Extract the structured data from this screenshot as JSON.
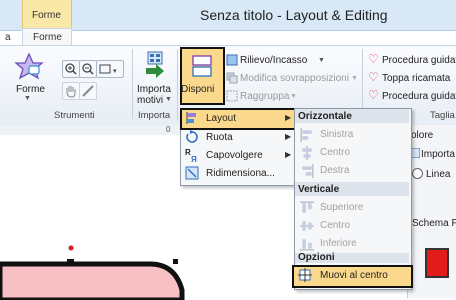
{
  "window": {
    "title": "Senza titolo - Layout & Editing"
  },
  "tabs": {
    "context_tab": "Forme",
    "left_tab_partial": "a",
    "active_tab": "Forme"
  },
  "ribbon": {
    "forme_label": "Forme",
    "strumenti_group": "Strumenti",
    "importa_motivi_line1": "Importa",
    "importa_motivi_line2": "motivi",
    "importa_group": "Importa",
    "disponi_label": "Disponi",
    "rilievo_incasso": "Rilievo/Incasso",
    "modifica_sovrapposizioni": "Modifica sovrapposizioni",
    "raggruppa": "Raggruppa",
    "procedura_guidata_1": "Procedura guidata",
    "toppa_ricamata": "Toppa ricamata",
    "procedura_guidata_2": "Procedura guidata",
    "taglia_group": "Taglia",
    "ruler_zero": "0"
  },
  "right_pane": {
    "colore_partial": "olore",
    "importa_partial": "Importa",
    "linea_label": "Linea",
    "schema_partial": "Schema Fil",
    "swatch_color": "#e21b1b"
  },
  "menu": {
    "items": [
      {
        "label": "Layout",
        "icon": "layout-icon"
      },
      {
        "label": "Ruota",
        "icon": "rotate-icon"
      },
      {
        "label": "Capovolgere",
        "icon": "flip-icon"
      },
      {
        "label": "Ridimensiona...",
        "icon": "resize-icon"
      }
    ]
  },
  "submenu": {
    "orizzontale_header": "Orizzontale",
    "sinistra": "Sinistra",
    "centro_h": "Centro",
    "destra": "Destra",
    "verticale_header": "Verticale",
    "superiore": "Superiore",
    "centro_v": "Centro",
    "inferiore": "Inferiore",
    "opzioni_header": "Opzioni",
    "muovi_al_centro": "Muovi al centro"
  },
  "colors": {
    "highlight": "#fbd98c",
    "shape_fill": "#f8c0c4",
    "title_bar": "#d9e8f7",
    "context_tab": "#fae8a8"
  }
}
